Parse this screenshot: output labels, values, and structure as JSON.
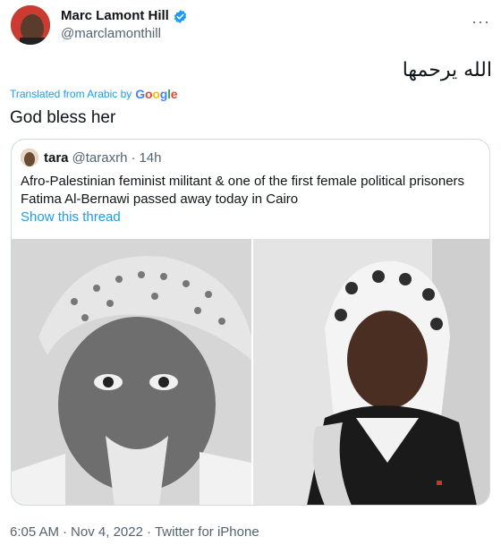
{
  "author": {
    "name": "Marc Lamont Hill",
    "handle": "@marclamonthill",
    "verified_color": "#1d9bf0"
  },
  "more_icon": "more-options-icon",
  "tweet": {
    "arabic_text": "الله يرحمها",
    "translated_label": "Translated from Arabic by",
    "google_label": "Google",
    "translation": "God bless her"
  },
  "quoted": {
    "name": "tara",
    "handle": "@taraxrh",
    "separator": "·",
    "time": "14h",
    "text": "Afro-Palestinian feminist militant & one of the first female political prisoners Fatima Al-Bernawi passed away today in Cairo",
    "show_thread": "Show this thread",
    "images": [
      "photo-left-bw-portrait",
      "photo-right-color-portrait"
    ]
  },
  "footer": {
    "time": "6:05 AM",
    "sep1": "·",
    "date": "Nov 4, 2022",
    "sep2": "·",
    "source": "Twitter for iPhone"
  },
  "colors": {
    "accent": "#1d9bf0",
    "muted": "#536471",
    "border": "#cfd9de"
  }
}
